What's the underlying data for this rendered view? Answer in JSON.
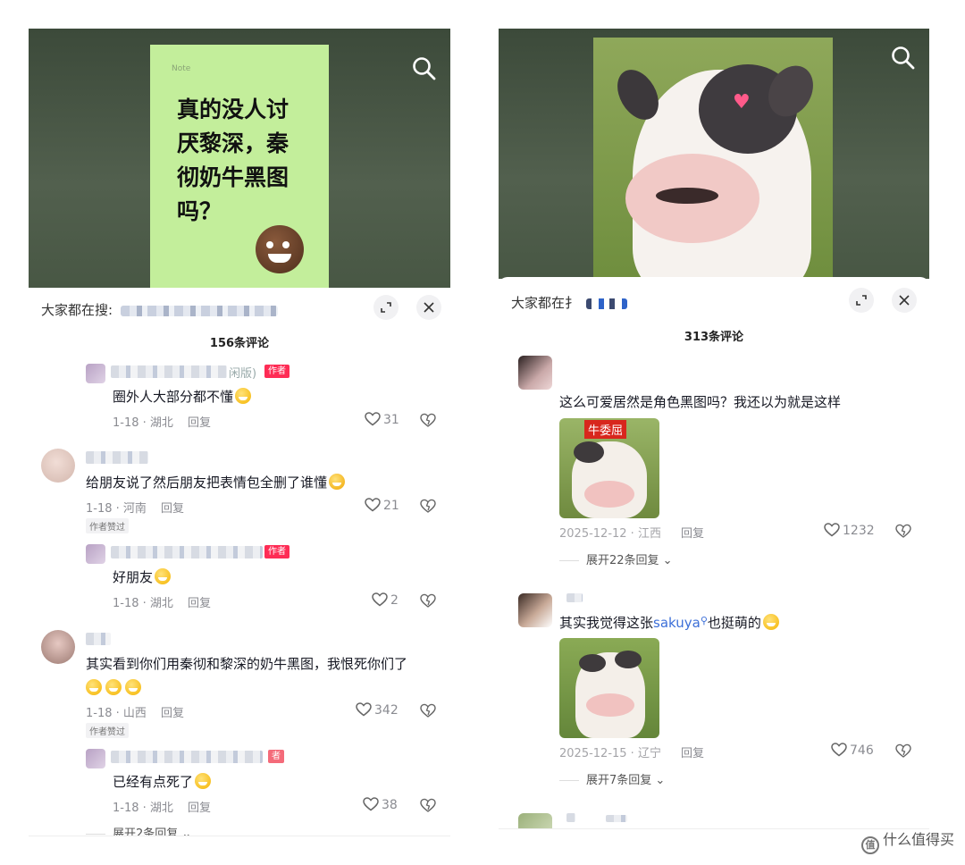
{
  "left": {
    "video": {
      "card_lines": [
        "真的没人讨",
        "厌黎深，秦",
        "彻奶牛黑图",
        "吗？"
      ],
      "card_brand": "Note"
    },
    "hot_search_label": "大家都在搜:",
    "comment_count": "156条评论",
    "comments": [
      {
        "author_suffix": "闲版)",
        "author_tag": "作者",
        "text": "圈外人大部分都不懂",
        "date_loc": "1-18 · 湖北",
        "reply": "回复",
        "likes": "31"
      },
      {
        "text": "给朋友说了然后朋友把表情包全删了谁懂",
        "date_loc": "1-18 · 河南",
        "reply": "回复",
        "likes": "21",
        "author_liked": "作者赞过"
      },
      {
        "author_tag": "作者",
        "text": "好朋友",
        "date_loc": "1-18 · 湖北",
        "reply": "回复",
        "likes": "2"
      },
      {
        "text": "其实看到你们用秦彻和黎深的奶牛黑图，我恨死你们了",
        "date_loc": "1-18 · 山西",
        "reply": "回复",
        "likes": "342",
        "author_liked": "作者赞过"
      },
      {
        "author_tag": "者",
        "text": "已经有点死了",
        "date_loc": "1-18 · 湖北",
        "reply": "回复",
        "likes": "38"
      }
    ],
    "expand_replies": "展开2条回复"
  },
  "right": {
    "hot_search_label": "大家都在扌",
    "comment_count": "313条评论",
    "comments": [
      {
        "text": "这么可爱居然是角色黑图吗？我还以为就是这样",
        "sticker_caption": "牛委屈",
        "date_loc": "2025-12-12 · 江西",
        "reply": "回复",
        "likes": "1232",
        "expand": "展开22条回复"
      },
      {
        "text_before": "其实我觉得这张",
        "link": "sakuya",
        "text_after": "也挺萌的",
        "date_loc": "2025-12-15 · 辽宁",
        "reply": "回复",
        "likes": "746",
        "expand": "展开7条回复"
      }
    ]
  },
  "watermark": "值 什么值得买",
  "colors": {
    "author_tag": "#fe2c55",
    "link": "#3c6fd8",
    "card_bg": "#c3ee9b",
    "highlight": "#a9dcf5"
  }
}
